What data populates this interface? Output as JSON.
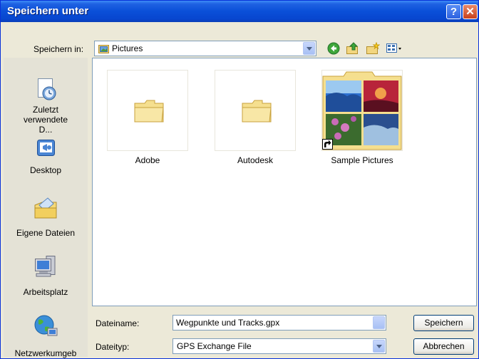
{
  "window": {
    "title": "Speichern unter",
    "help_label": "?",
    "close_label": "✕"
  },
  "location": {
    "label": "Speichern in:",
    "value": "Pictures"
  },
  "toolbar": {
    "icons": [
      "back-icon",
      "up-folder-icon",
      "new-folder-icon",
      "view-menu-icon"
    ]
  },
  "places": [
    {
      "label": "Zuletzt verwendete D...",
      "icon": "recent-documents-icon"
    },
    {
      "label": "Desktop",
      "icon": "desktop-icon"
    },
    {
      "label": "Eigene Dateien",
      "icon": "my-documents-icon"
    },
    {
      "label": "Arbeitsplatz",
      "icon": "my-computer-icon"
    },
    {
      "label": "Netzwerkumgeb",
      "icon": "network-icon"
    }
  ],
  "files": [
    {
      "name": "Adobe",
      "icon": "folder-icon"
    },
    {
      "name": "Autodesk",
      "icon": "folder-icon"
    },
    {
      "name": "Sample Pictures",
      "icon": "shortcut-folder-icon"
    }
  ],
  "filename": {
    "label": "Dateiname:",
    "value": "Wegpunkte und Tracks.gpx"
  },
  "filetype": {
    "label": "Dateityp:",
    "value": "GPS Exchange File"
  },
  "buttons": {
    "save": "Speichern",
    "cancel": "Abbrechen"
  },
  "colors": {
    "titlebar": "#0a4fd8",
    "dialog_bg": "#ece9d8",
    "border": "#7f9db9"
  }
}
